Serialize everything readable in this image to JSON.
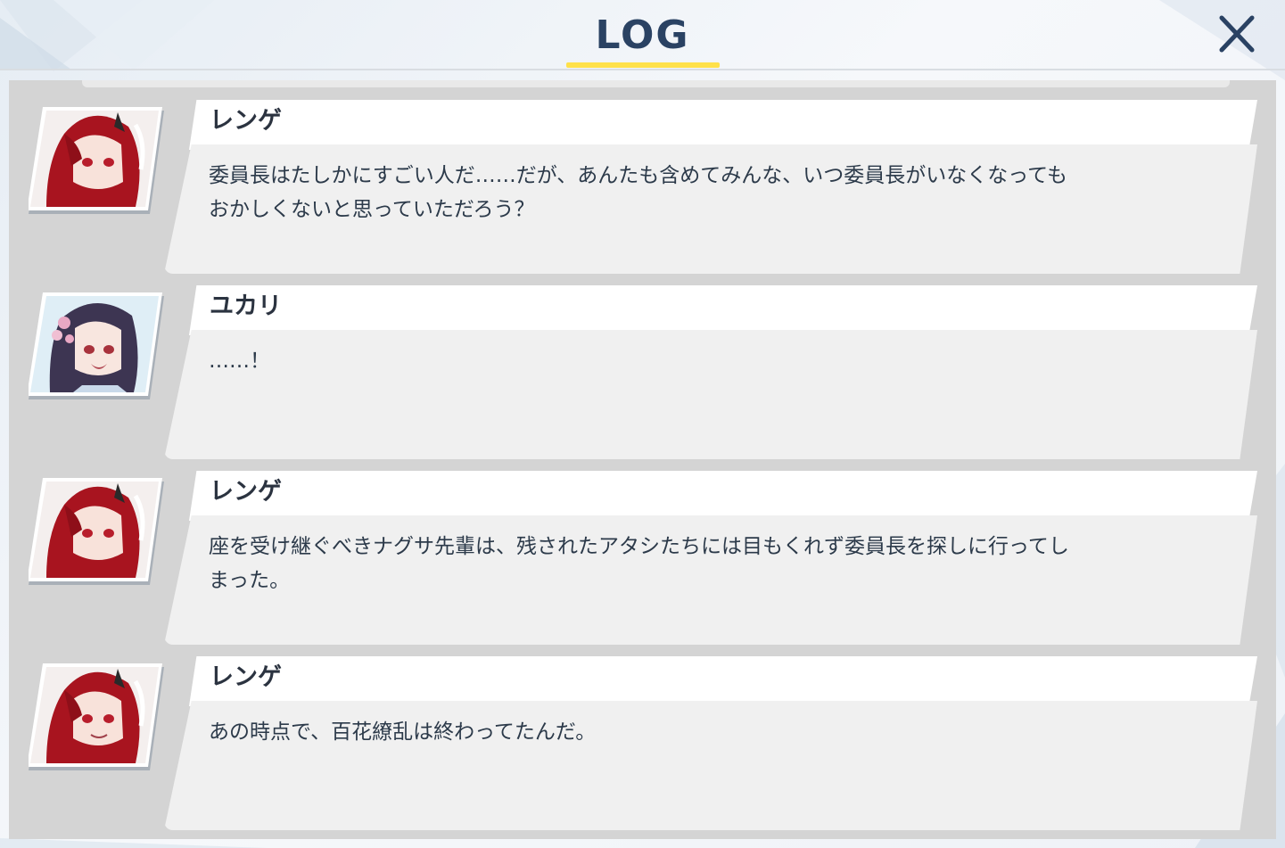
{
  "header": {
    "title": "LOG",
    "close_icon": "close-icon"
  },
  "colors": {
    "title": "#2a4263",
    "underline": "#ffe14a",
    "panel": "#d4d4d4",
    "name_bar": "#ffffff",
    "message_box": "#f0f0f0",
    "text": "#2c3a4a"
  },
  "entries": [
    {
      "speaker": "レンゲ",
      "avatar": "renge-portrait",
      "text": "委員長はたしかにすごい人だ……だが、あんたも含めてみんな、いつ委員長がいなくなっても\nおかしくないと思っていただろう？"
    },
    {
      "speaker": "ユカリ",
      "avatar": "yukari-portrait",
      "text": "……！"
    },
    {
      "speaker": "レンゲ",
      "avatar": "renge-portrait",
      "text": "座を受け継ぐべきナグサ先輩は、残されたアタシたちには目もくれず委員長を探しに行ってし\nまった。"
    },
    {
      "speaker": "レンゲ",
      "avatar": "renge-portrait",
      "text": "あの時点で、百花繚乱は終わってたんだ。"
    }
  ]
}
